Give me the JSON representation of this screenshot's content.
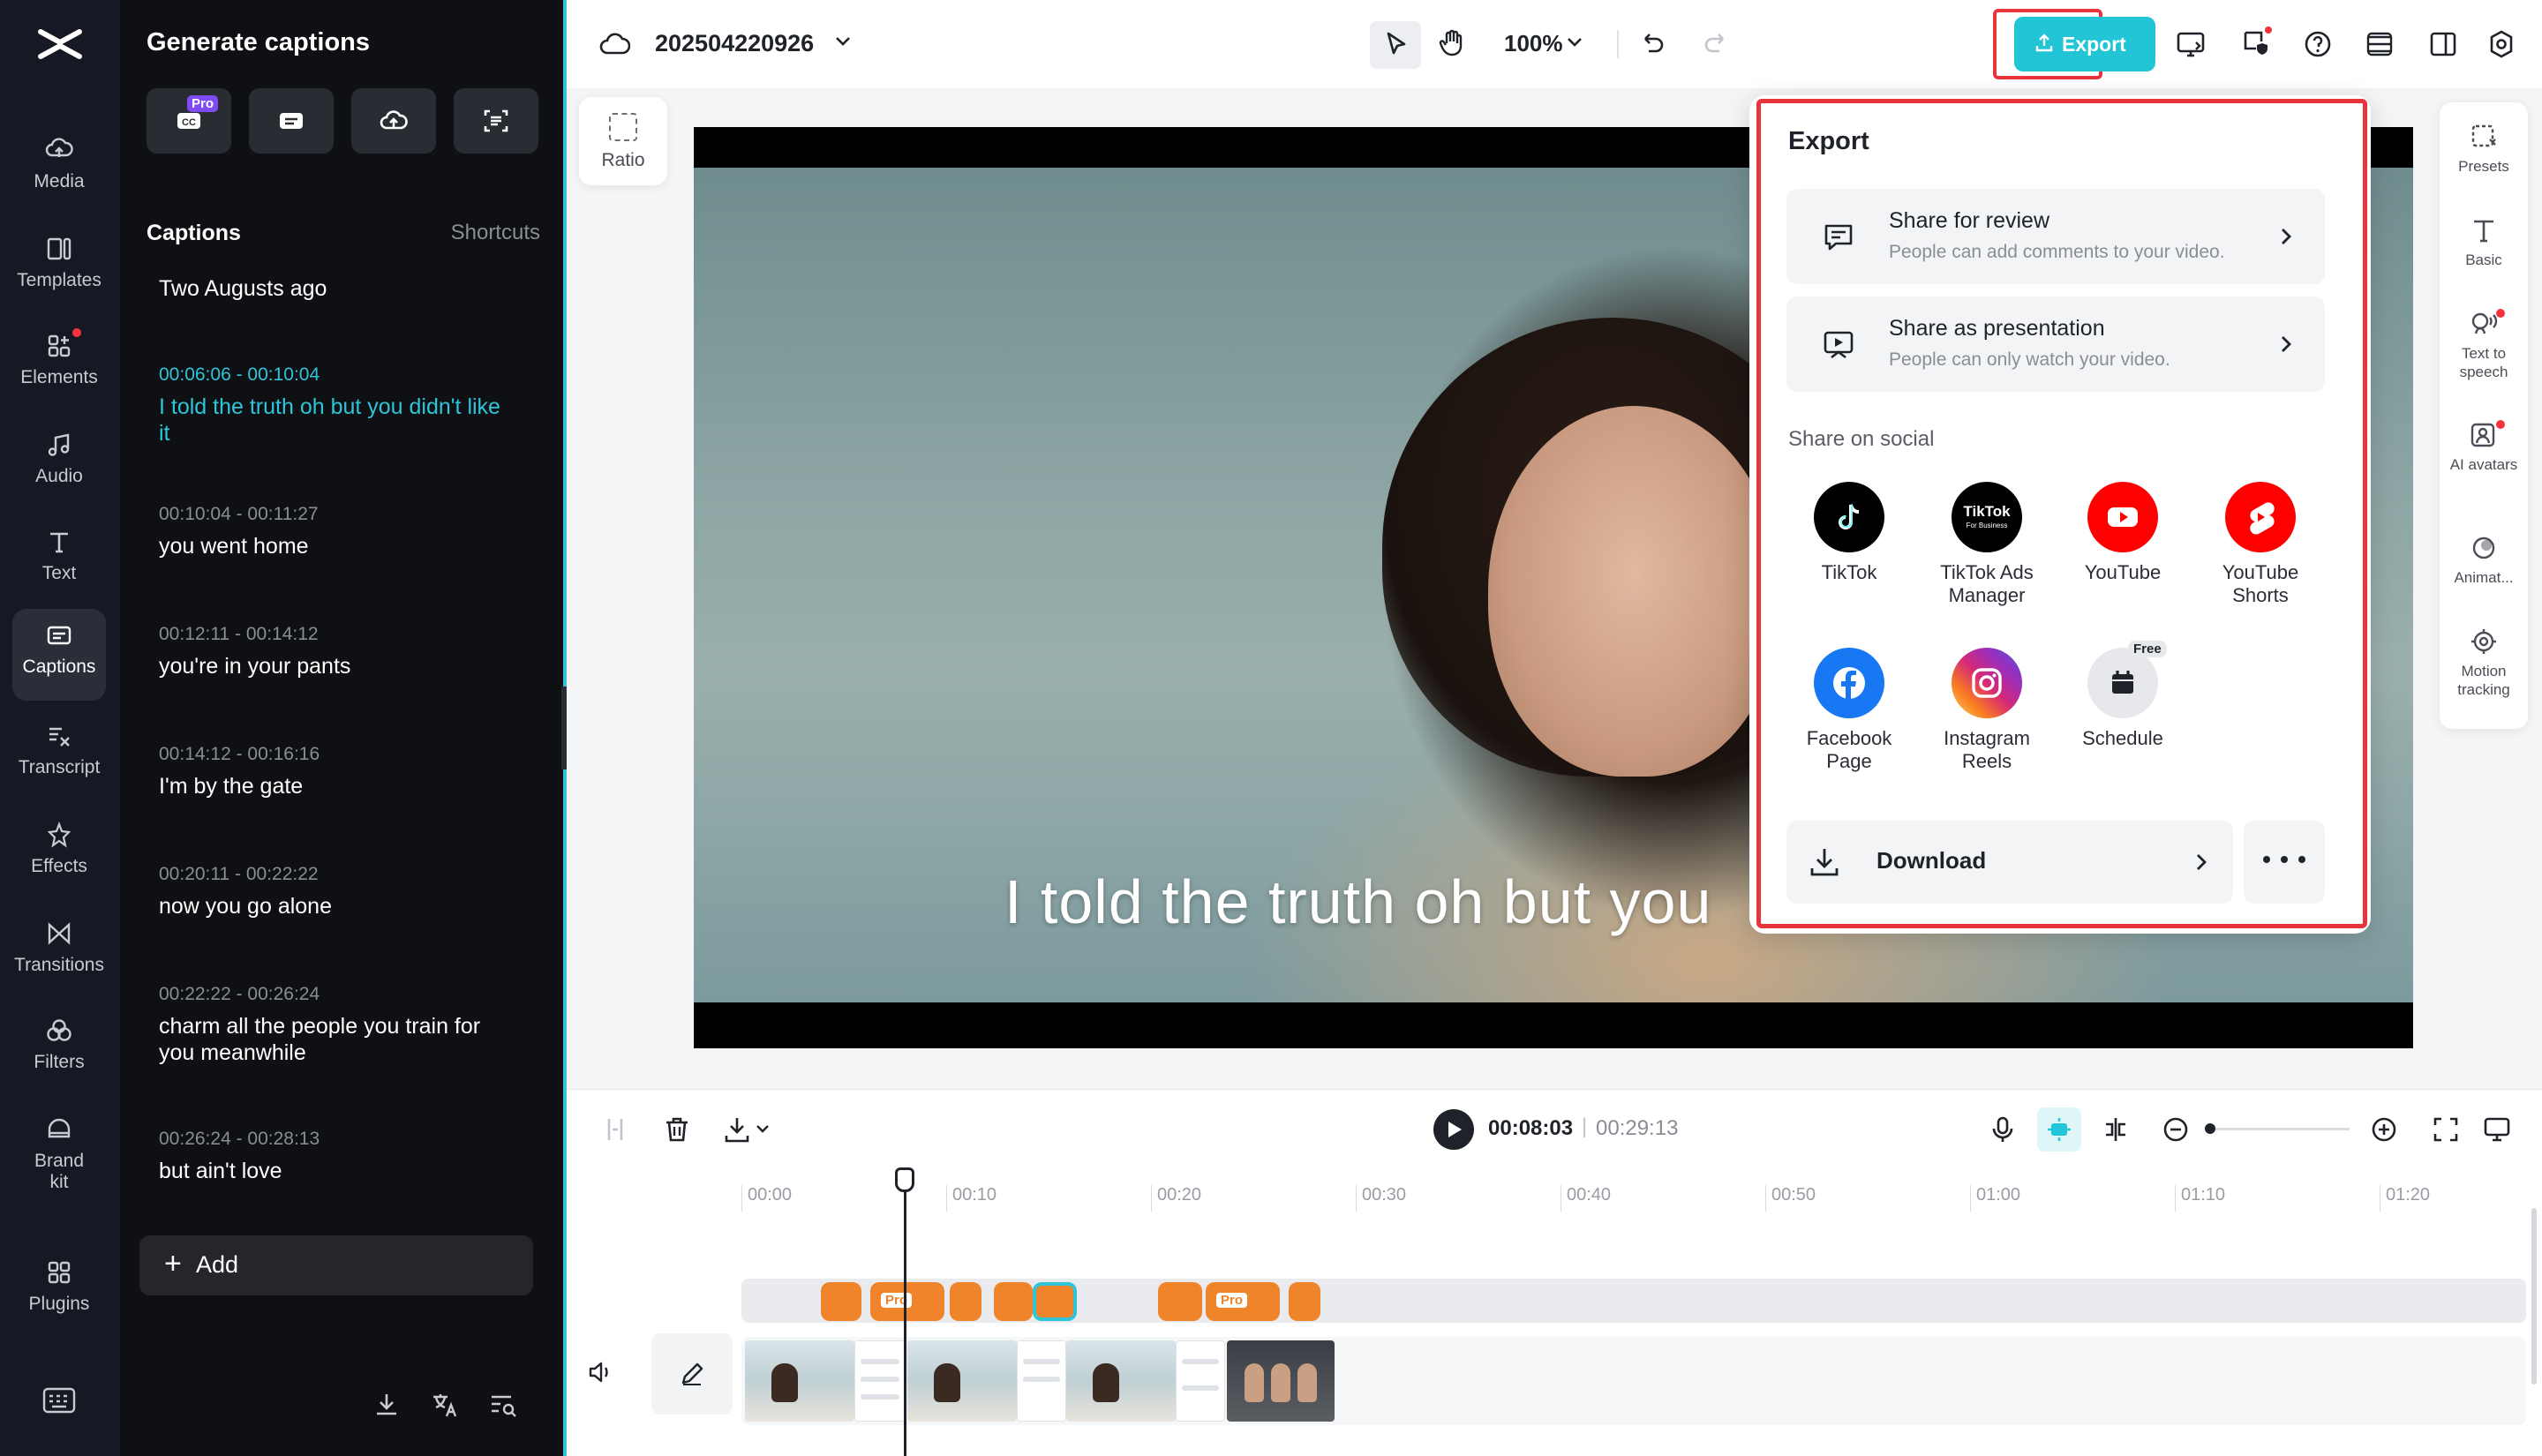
{
  "rail": {
    "items": [
      {
        "label": "Media",
        "icon": "media-icon"
      },
      {
        "label": "Templates",
        "icon": "templates-icon"
      },
      {
        "label": "Elements",
        "icon": "elements-icon"
      },
      {
        "label": "Audio",
        "icon": "audio-icon"
      },
      {
        "label": "Text",
        "icon": "text-icon"
      },
      {
        "label": "Captions",
        "icon": "captions-icon"
      },
      {
        "label": "Transcript",
        "icon": "transcript-icon"
      },
      {
        "label": "Effects",
        "icon": "effects-icon"
      },
      {
        "label": "Transitions",
        "icon": "transitions-icon"
      },
      {
        "label": "Filters",
        "icon": "filters-icon"
      },
      {
        "label": "Brand kit",
        "icon": "brand-kit-icon"
      },
      {
        "label": "Plugins",
        "icon": "plugins-icon"
      }
    ]
  },
  "captions_panel": {
    "title": "Generate captions",
    "pro_tag": "Pro",
    "section_title": "Captions",
    "shortcuts": "Shortcuts",
    "items": [
      {
        "time": "",
        "text": "Two Augusts ago"
      },
      {
        "time": "00:06:06 - 00:10:04",
        "text": "I told the truth oh but you didn't like it"
      },
      {
        "time": "00:10:04 - 00:11:27",
        "text": "you went home"
      },
      {
        "time": "00:12:11 - 00:14:12",
        "text": "you're in your pants"
      },
      {
        "time": "00:14:12 - 00:16:16",
        "text": "I'm by the gate"
      },
      {
        "time": "00:20:11 - 00:22:22",
        "text": "now you go alone"
      },
      {
        "time": "00:22:22 - 00:26:24",
        "text": "charm all the people you train for you meanwhile"
      },
      {
        "time": "00:26:24 - 00:28:13",
        "text": "but ain't love"
      }
    ],
    "add_label": "Add"
  },
  "topbar": {
    "project_name": "202504220926",
    "zoom": "100%",
    "export_label": "Export"
  },
  "ratio_label": "Ratio",
  "video": {
    "subtitle": "I told the truth oh but you"
  },
  "right_tools": [
    {
      "label": "Presets"
    },
    {
      "label": "Basic"
    },
    {
      "label": "Text to speech"
    },
    {
      "label": "AI avatars"
    },
    {
      "label": "Animat..."
    },
    {
      "label": "Motion tracking"
    }
  ],
  "export_panel": {
    "title": "Export",
    "share_review": {
      "title": "Share for review",
      "desc": "People can add comments to your video."
    },
    "share_presentation": {
      "title": "Share as presentation",
      "desc": "People can only watch your video."
    },
    "social_title": "Share on social",
    "social": [
      {
        "label": "TikTok",
        "color": "#000000"
      },
      {
        "label": "TikTok Ads Manager",
        "color": "#000000"
      },
      {
        "label": "YouTube",
        "color": "#ff0000"
      },
      {
        "label": "YouTube Shorts",
        "color": "#ff0000"
      },
      {
        "label": "Facebook Page",
        "color": "#1877f2"
      },
      {
        "label": "Instagram Reels",
        "color": "#d62976"
      },
      {
        "label": "Schedule",
        "color": "#e6e8ec"
      }
    ],
    "tiktok_ads_logo": "TikTok",
    "tiktok_ads_sub": "For Business",
    "free_tag": "Free",
    "download_label": "Download"
  },
  "timeline": {
    "current_time": "00:08:03",
    "separator": "|",
    "total_time": "00:29:13",
    "ruler": [
      "00:00",
      "00:10",
      "00:20",
      "00:30",
      "00:40",
      "00:50",
      "01:00",
      "01:10",
      "01:20"
    ],
    "pro_tag": "Pro"
  },
  "colors": {
    "accent": "#22c5d6",
    "highlight_red": "#e8343b",
    "clip_orange": "#f0842a"
  }
}
